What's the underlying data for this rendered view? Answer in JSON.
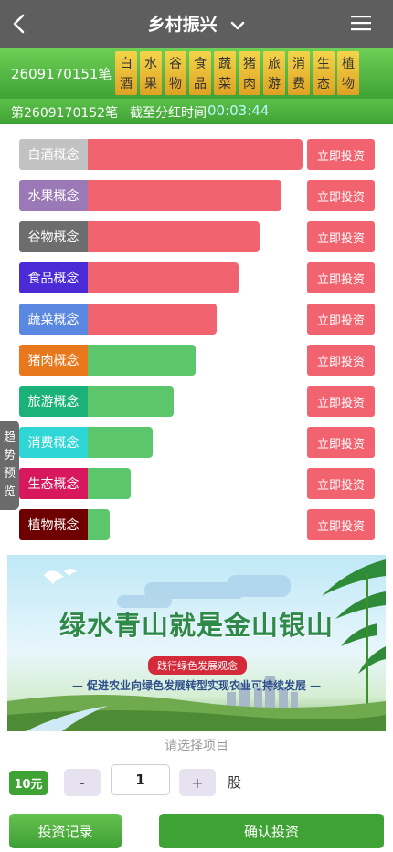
{
  "header": {
    "title": "乡村振兴"
  },
  "period": {
    "current": "2609170151笔",
    "items": [
      {
        "top": "白",
        "bottom": "酒"
      },
      {
        "top": "水",
        "bottom": "果"
      },
      {
        "top": "谷",
        "bottom": "物"
      },
      {
        "top": "食",
        "bottom": "品"
      },
      {
        "top": "蔬",
        "bottom": "菜"
      },
      {
        "top": "猪",
        "bottom": "肉"
      },
      {
        "top": "旅",
        "bottom": "游"
      },
      {
        "top": "消",
        "bottom": "费"
      },
      {
        "top": "生",
        "bottom": "态"
      },
      {
        "top": "植",
        "bottom": "物"
      }
    ],
    "next": "第2609170152笔",
    "deadline_label": "截至分红时间",
    "deadline_time": "00:03:44"
  },
  "concepts": [
    {
      "label": "白酒概念",
      "level": 1.0,
      "label_color": "#c2c2c2",
      "bar_color": "#f26370",
      "button": "立即投资"
    },
    {
      "label": "水果概念",
      "level": 0.9,
      "label_color": "#9b78b6",
      "bar_color": "#f26370",
      "button": "立即投资"
    },
    {
      "label": "谷物概念",
      "level": 0.8,
      "label_color": "#6d6d6d",
      "bar_color": "#f26370",
      "button": "立即投资"
    },
    {
      "label": "食品概念",
      "level": 0.7,
      "label_color": "#4a2bd6",
      "bar_color": "#f26370",
      "button": "立即投资"
    },
    {
      "label": "蔬菜概念",
      "level": 0.6,
      "label_color": "#5a88e0",
      "bar_color": "#f26370",
      "button": "立即投资"
    },
    {
      "label": "猪肉概念",
      "level": 0.5,
      "label_color": "#e9781c",
      "bar_color": "#5cc66c",
      "button": "立即投资"
    },
    {
      "label": "旅游概念",
      "level": 0.4,
      "label_color": "#1bb27a",
      "bar_color": "#5cc66c",
      "button": "立即投资"
    },
    {
      "label": "消费概念",
      "level": 0.3,
      "label_color": "#2ed6d6",
      "bar_color": "#5cc66c",
      "button": "立即投资"
    },
    {
      "label": "生态概念",
      "level": 0.2,
      "label_color": "#d8185d",
      "bar_color": "#5cc66c",
      "button": "立即投资"
    },
    {
      "label": "植物概念",
      "level": 0.1,
      "label_color": "#6e0000",
      "bar_color": "#5cc66c",
      "button": "立即投资"
    }
  ],
  "side_tab": {
    "chars": [
      "趋",
      "势",
      "预",
      "览"
    ]
  },
  "banner": {
    "slogan": "绿水青山就是金山银山",
    "tag": "践行绿色发展观念",
    "subtitle": "— 促进农业向绿色发展转型实现农业可持续发展 —"
  },
  "select_hint": "请选择项目",
  "order": {
    "price": "10元",
    "minus": "-",
    "quantity": "1",
    "plus": "+",
    "unit": "股"
  },
  "buttons": {
    "records": "投资记录",
    "confirm": "确认投资"
  }
}
